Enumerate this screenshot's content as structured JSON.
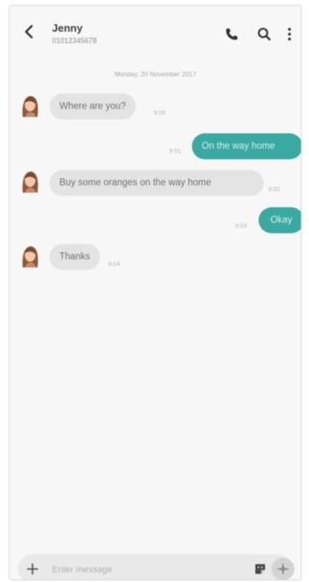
{
  "header": {
    "contact_name": "Jenny",
    "contact_number": "01012345678"
  },
  "conversation": {
    "date_divider": "Monday, 20 November 2017",
    "messages": [
      {
        "direction": "in",
        "text": "Where are you?",
        "time": "9:00"
      },
      {
        "direction": "out",
        "text": "On the way home",
        "time": "9:01"
      },
      {
        "direction": "in",
        "text": "Buy some oranges on the way home",
        "time": "9:02"
      },
      {
        "direction": "out",
        "text": "Okay",
        "time": "9:03"
      },
      {
        "direction": "in",
        "text": "Thanks",
        "time": "9:04"
      }
    ]
  },
  "composer": {
    "placeholder": "Enter message"
  },
  "colors": {
    "accent": "#3aa9a1",
    "incoming_bubble": "#e3e3e3",
    "background": "#f7f7f7"
  },
  "icons": {
    "back": "chevron-left-icon",
    "call": "phone-icon",
    "search": "search-icon",
    "more": "more-vertical-icon",
    "add": "plus-icon",
    "sticker": "sticker-icon",
    "send": "send-icon"
  }
}
